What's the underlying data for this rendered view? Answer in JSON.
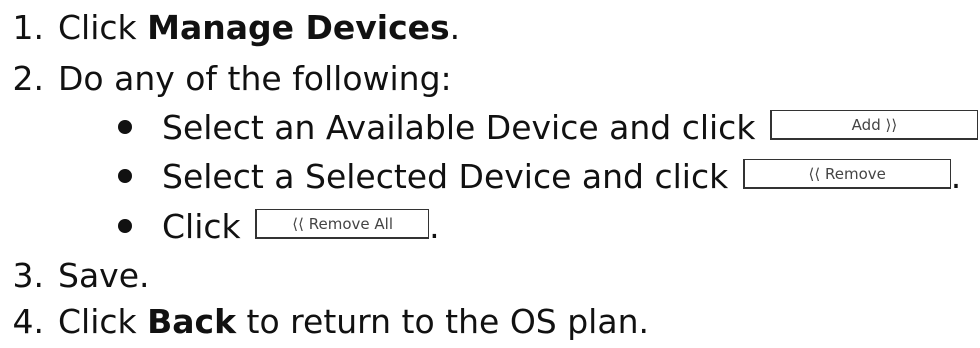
{
  "steps": [
    {
      "num": "1.",
      "pre": "Click ",
      "bold": "Manage Devices",
      "post": "."
    },
    {
      "num": "2.",
      "text": "Do any of the following:"
    },
    {
      "num": "3.",
      "text": "Save."
    },
    {
      "num": "4.",
      "pre": "Click ",
      "bold": "Back",
      "post": " to return to the OS plan."
    }
  ],
  "substeps": [
    {
      "text": "Select an Available Device and click",
      "button": "Add ⟩⟩",
      "post": ""
    },
    {
      "text": "Select a Selected Device and click",
      "button": "⟨⟨ Remove",
      "post": "."
    },
    {
      "text": "Click",
      "button": "⟨⟨ Remove All",
      "post": "."
    }
  ]
}
